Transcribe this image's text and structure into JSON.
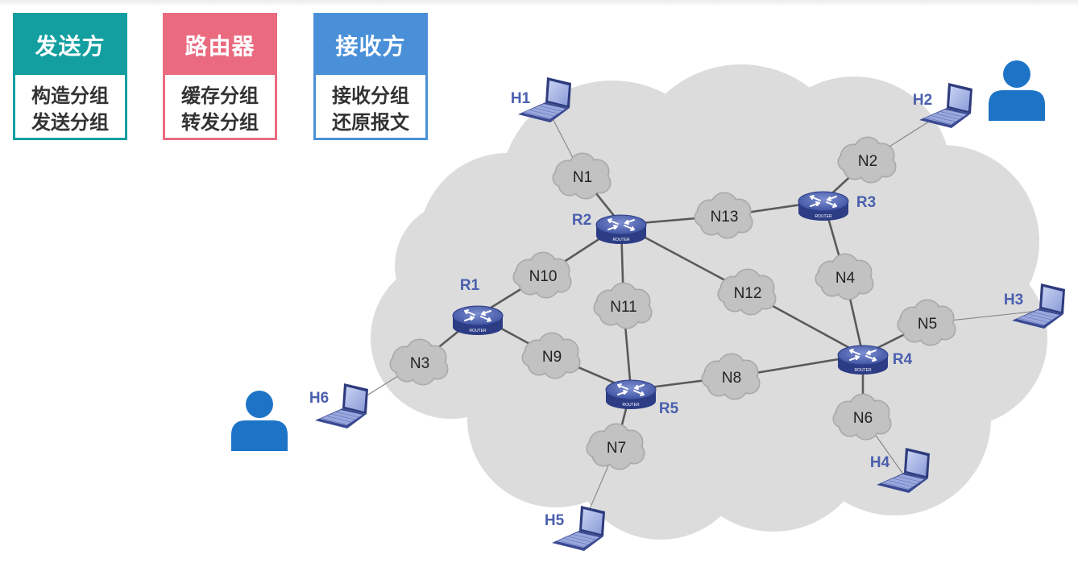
{
  "roles": {
    "sender": {
      "title": "发送方",
      "lines": [
        "构造分组",
        "发送分组"
      ],
      "color": "#139fa0"
    },
    "router": {
      "title": "路由器",
      "lines": [
        "缓存分组",
        "转发分组"
      ],
      "color": "#ea6b80"
    },
    "receiver": {
      "title": "接收方",
      "lines": [
        "接收分组",
        "还原报文"
      ],
      "color": "#4a90d8"
    }
  },
  "network": {
    "router_badge_text": "ROUTER",
    "routers": [
      "R1",
      "R2",
      "R3",
      "R4",
      "R5"
    ],
    "networks": [
      "N1",
      "N2",
      "N3",
      "N4",
      "N5",
      "N6",
      "N7",
      "N8",
      "N9",
      "N10",
      "N11",
      "N12",
      "N13"
    ],
    "hosts": [
      "H1",
      "H2",
      "H3",
      "H4",
      "H5",
      "H6"
    ],
    "users": [
      "user-left",
      "user-right"
    ],
    "colors": {
      "router": "#4a5fae",
      "label": "#4a5fae",
      "cloud": "#dcdcdc",
      "user": "#1d74c7"
    }
  }
}
